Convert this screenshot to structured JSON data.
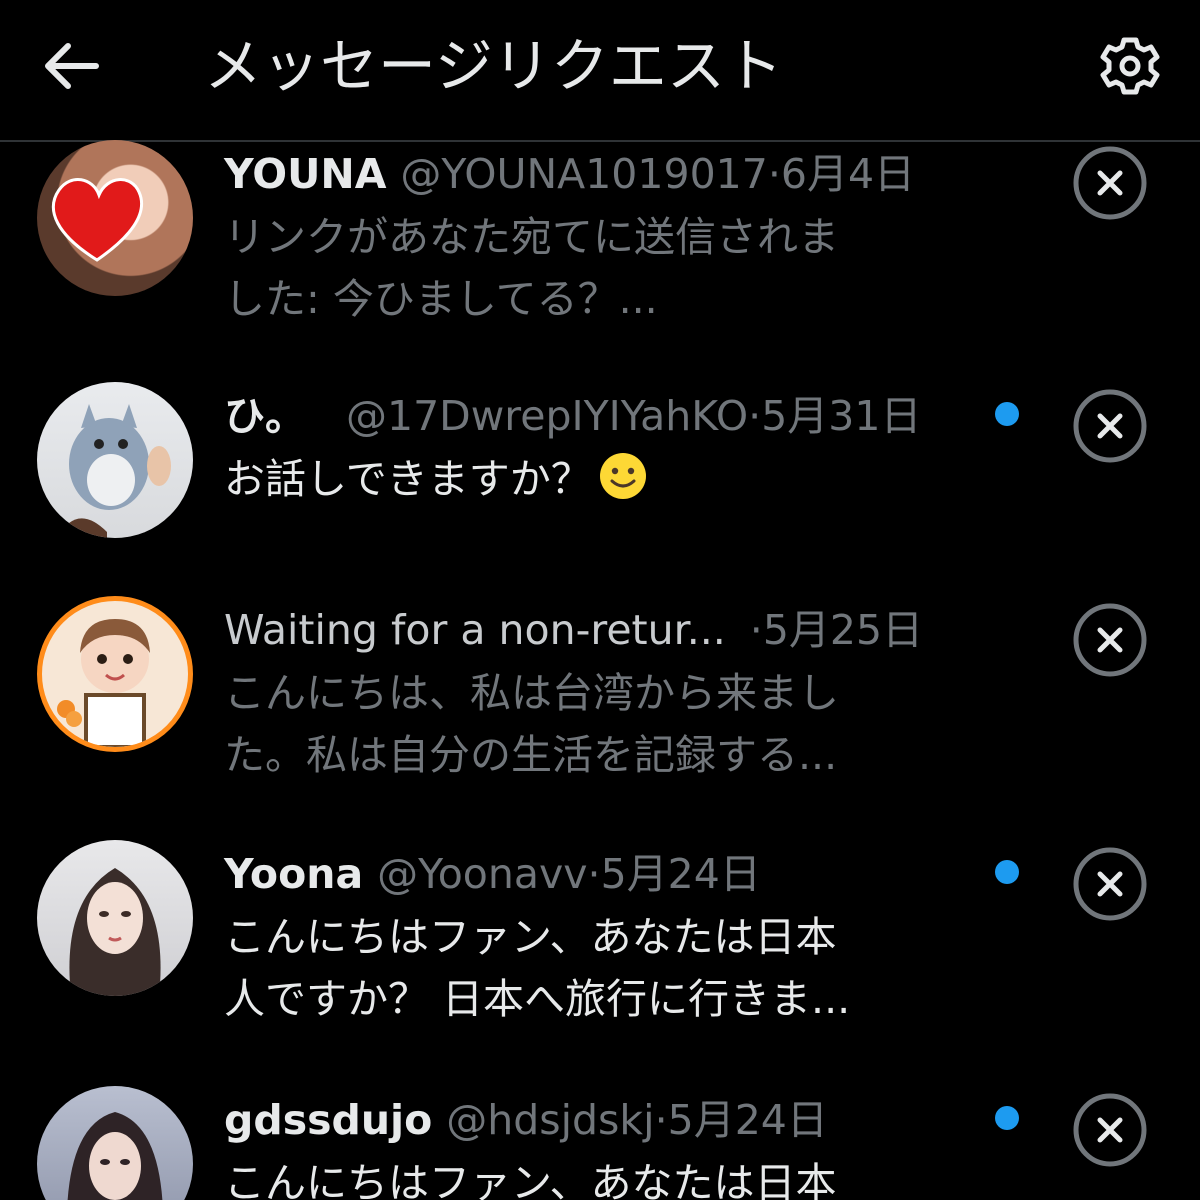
{
  "header": {
    "title": "メッセージリクエスト",
    "back_icon": "back-arrow-icon",
    "settings_icon": "gear-icon"
  },
  "colors": {
    "background": "#000000",
    "primary_text": "#e7e9ea",
    "secondary_text": "#71767b",
    "unread_dot": "#1d9bf0",
    "divider": "#2f3336"
  },
  "requests": [
    {
      "name": "YOUNA",
      "handle": "@YOUNA1019017",
      "separator": "·",
      "date": "6月4日",
      "message_lines": [
        "リンクがあなた宛てに送信されま",
        "した: 今ひましてる？..."
      ],
      "unread": false
    },
    {
      "name": "ひ。",
      "handle": "@17DwrepIYIYahKO",
      "separator": "·",
      "date": "5月31日",
      "message_lines": [
        "お話しできますか？"
      ],
      "emoji": "slightly-smiling-face-icon",
      "unread": true
    },
    {
      "name": "Waiting for a non-retur...",
      "handle": "",
      "separator": "·",
      "date": "5月25日",
      "message_lines": [
        "こんにちは、私は台湾から来まし",
        "た。私は自分の生活を記録する..."
      ],
      "unread": false
    },
    {
      "name": "Yoona",
      "handle": "@Yoonavv",
      "separator": "·",
      "date": "5月24日",
      "message_lines": [
        "こんにちはファン、あなたは日本",
        "人ですか？ 日本へ旅行に行きま..."
      ],
      "unread": true
    },
    {
      "name": "gdssdujo",
      "handle": "@hdsjdskj",
      "separator": "·",
      "date": "5月24日",
      "message_lines": [
        "こんにちはファン、あなたは日本"
      ],
      "unread": true
    }
  ]
}
